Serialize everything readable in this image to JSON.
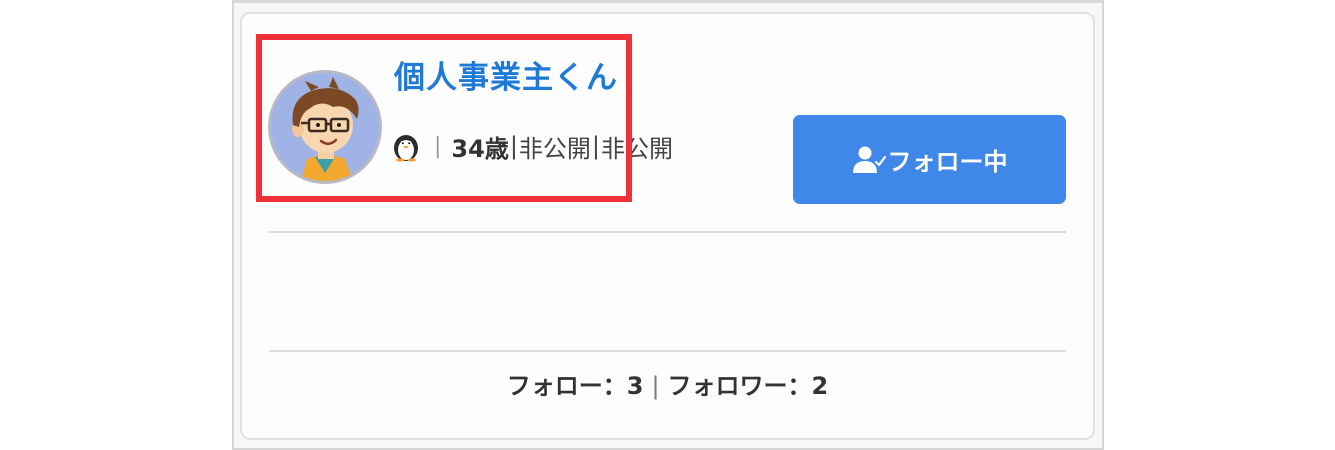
{
  "profile": {
    "name": "個人事業主くん",
    "avatar_icon": "cartoon-man-with-glasses-avatar",
    "platform_icon": "penguin-icon",
    "age": "34歳",
    "field_1": "非公開",
    "field_2": "非公開",
    "separator": "|"
  },
  "follow_button": {
    "icon": "user-check-icon",
    "label": "フォロー中",
    "color": "#3f87e8"
  },
  "stats": {
    "following_label": "フォロー：",
    "following_count": "3",
    "divider": "|",
    "followers_label": "フォロワー：",
    "followers_count": "2"
  },
  "highlight_color": "#f0313a",
  "name_color": "#1f7ad6"
}
